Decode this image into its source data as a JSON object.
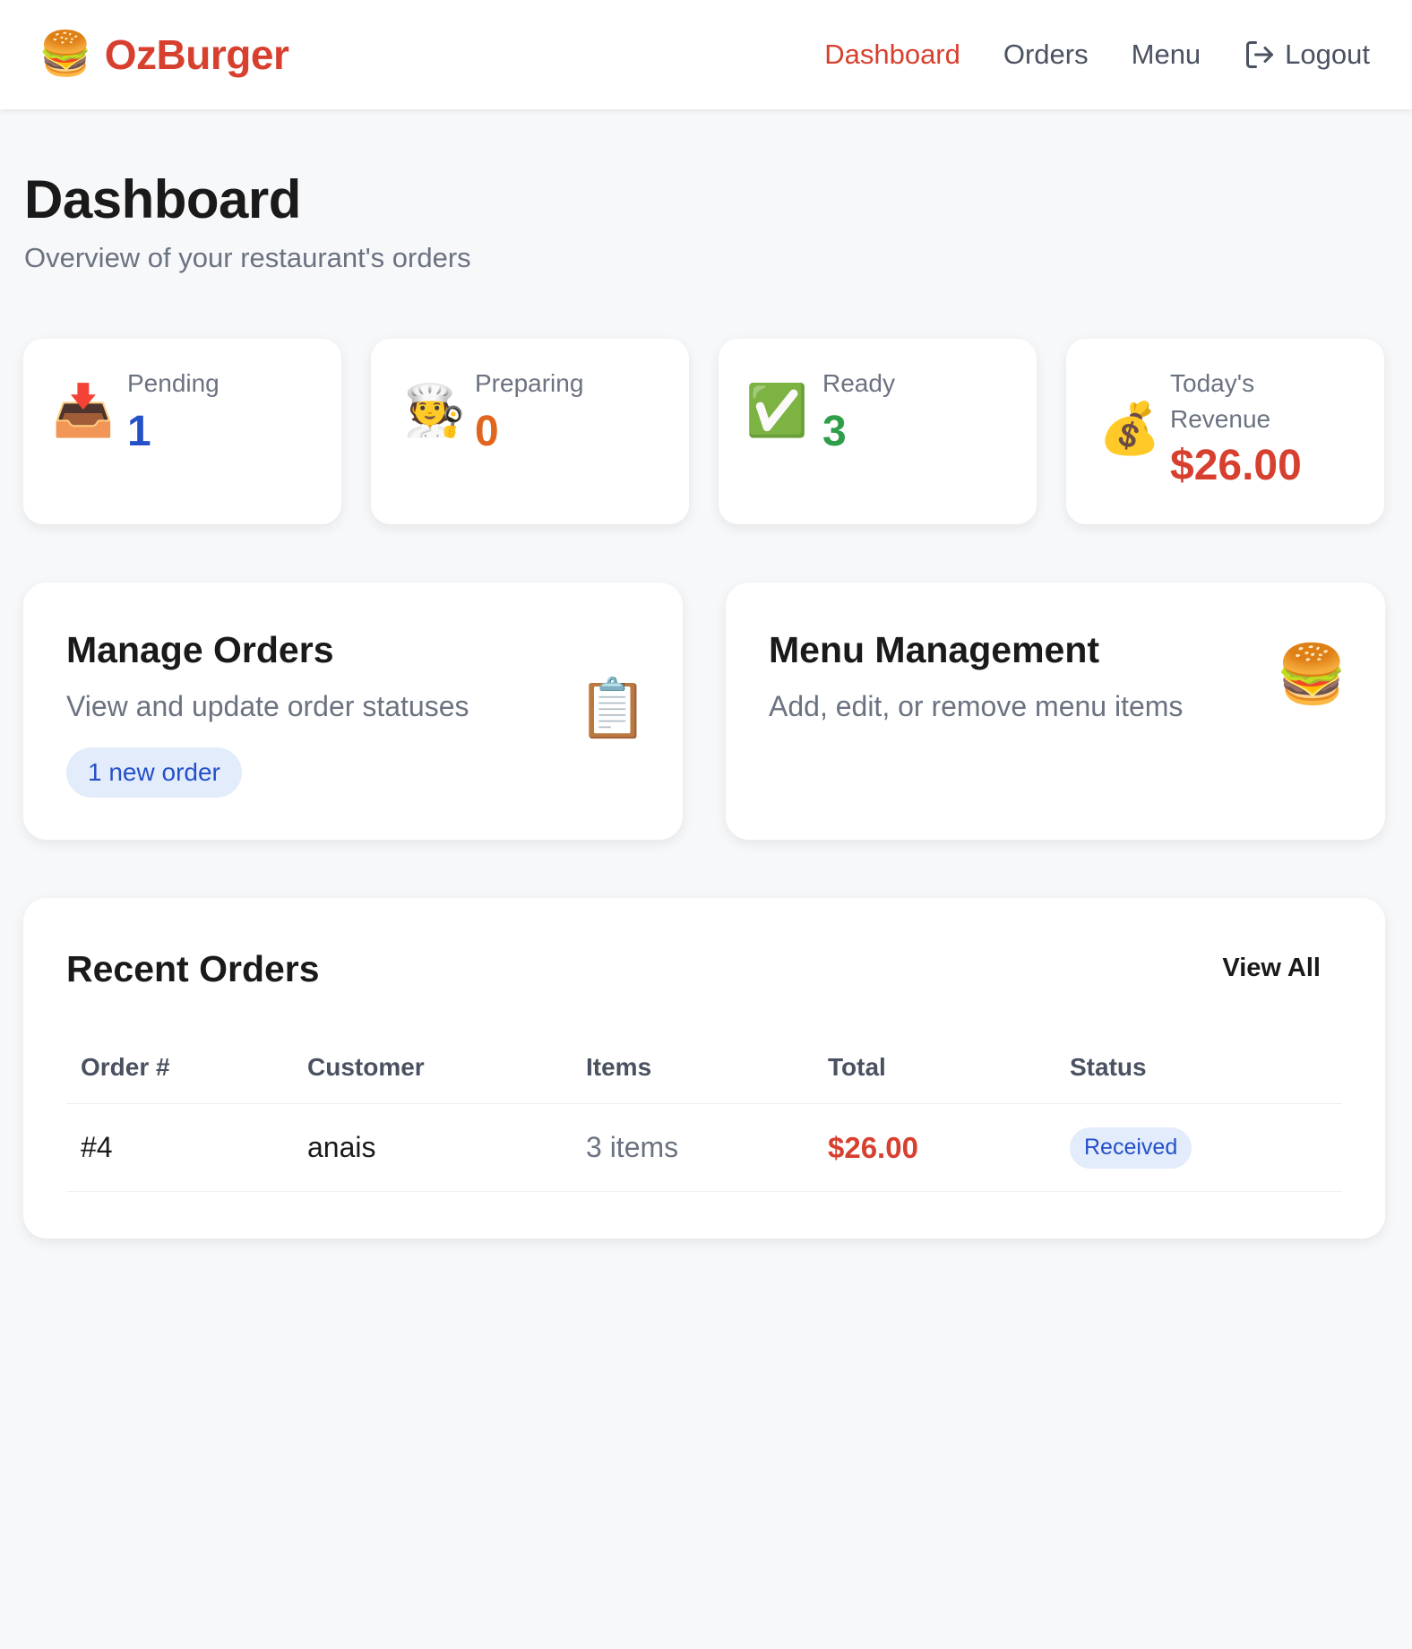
{
  "brand": {
    "icon": "🍔",
    "name": "OzBurger"
  },
  "nav": {
    "dashboard": "Dashboard",
    "orders": "Orders",
    "menu": "Menu",
    "logout": "Logout"
  },
  "header": {
    "title": "Dashboard",
    "subtitle": "Overview of your restaurant's orders"
  },
  "stats": {
    "pending": {
      "icon": "📥",
      "label": "Pending",
      "value": "1",
      "color": "#2450c8"
    },
    "preparing": {
      "icon": "🧑‍🍳",
      "label": "Preparing",
      "value": "0",
      "color": "#e0651e"
    },
    "ready": {
      "icon": "✅",
      "label": "Ready",
      "value": "3",
      "color": "#2f9e48"
    },
    "revenue": {
      "icon": "💰",
      "label_line1": "Today's",
      "label_line2": "Revenue",
      "value": "$26.00",
      "color": "#d7402f"
    }
  },
  "manage_orders": {
    "title": "Manage Orders",
    "description": "View and update order statuses",
    "badge": "1 new order",
    "icon": "📋"
  },
  "menu_management": {
    "title": "Menu Management",
    "description": "Add, edit, or remove menu items",
    "icon": "🍔"
  },
  "recent_orders": {
    "title": "Recent Orders",
    "view_all": "View All",
    "columns": [
      "Order #",
      "Customer",
      "Items",
      "Total",
      "Status"
    ],
    "rows": [
      {
        "order": "#4",
        "customer": "anais",
        "items": "3 items",
        "total": "$26.00",
        "status": "Received"
      }
    ]
  },
  "colors": {
    "brand": "#d7402f",
    "status_bg": "#e3ecfb",
    "status_text": "#2450c8"
  }
}
